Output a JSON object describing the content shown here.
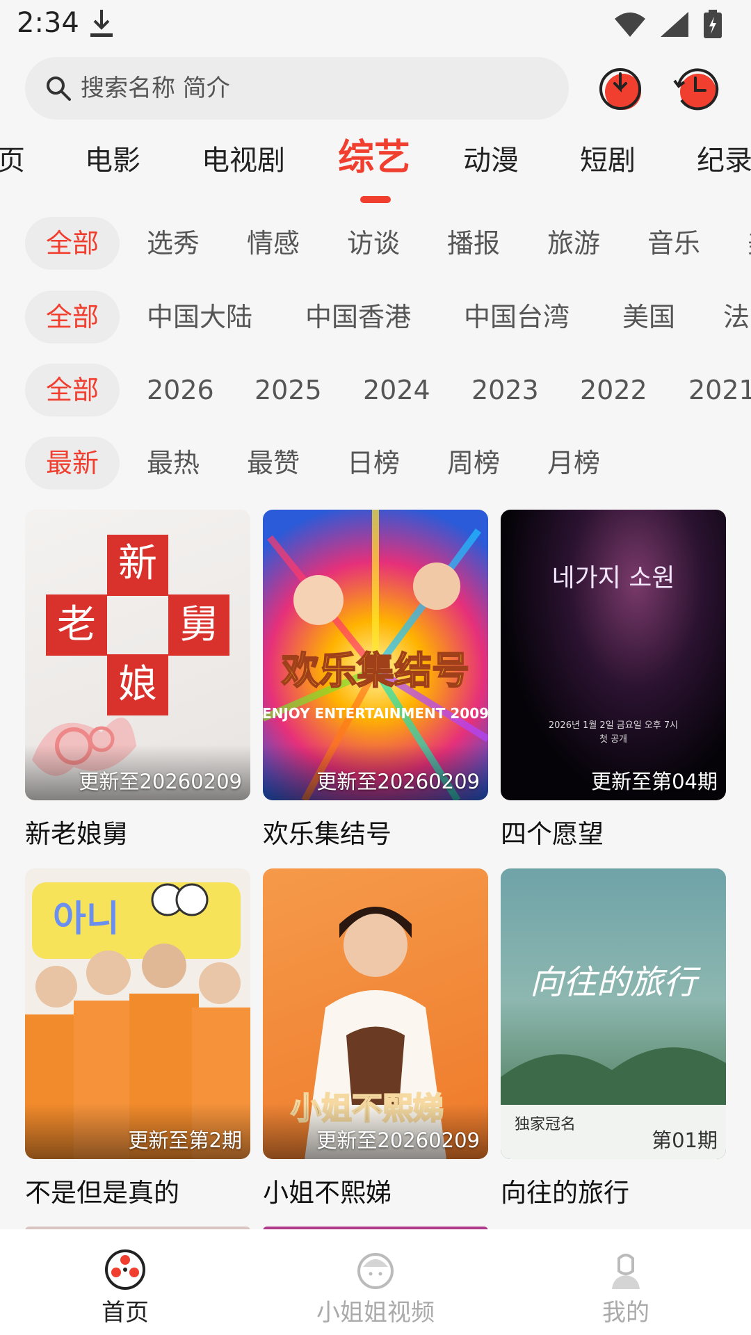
{
  "status_bar": {
    "time": "2:34"
  },
  "search": {
    "placeholder": "搜索名称 简介"
  },
  "tabs": [
    {
      "label": "页"
    },
    {
      "label": "电影"
    },
    {
      "label": "电视剧"
    },
    {
      "label": "综艺"
    },
    {
      "label": "动漫"
    },
    {
      "label": "短剧"
    },
    {
      "label": "纪录"
    }
  ],
  "active_tab": "综艺",
  "filters": {
    "genre": [
      "全部",
      "选秀",
      "情感",
      "访谈",
      "播报",
      "旅游",
      "音乐",
      "美"
    ],
    "region": [
      "全部",
      "中国大陆",
      "中国香港",
      "中国台湾",
      "美国",
      "法"
    ],
    "year": [
      "全部",
      "2026",
      "2025",
      "2024",
      "2023",
      "2022",
      "2021"
    ],
    "sort": [
      "最新",
      "最热",
      "最赞",
      "日榜",
      "周榜",
      "月榜"
    ]
  },
  "cards": [
    {
      "title": "新老娘舅",
      "badge": "更新至20260209"
    },
    {
      "title": "欢乐集结号",
      "badge": "更新至20260209"
    },
    {
      "title": "四个愿望",
      "badge": "更新至第04期"
    },
    {
      "title": "不是但是真的",
      "badge": "更新至第2期"
    },
    {
      "title": "小姐不熙娣",
      "badge": "更新至20260209"
    },
    {
      "title": "向往的旅行",
      "badge": "第01期"
    }
  ],
  "poster_text": {
    "card1": [
      "新",
      "老",
      "舅",
      "娘"
    ],
    "card2_logo": "欢乐集结号",
    "card2_sub": "ENJOY ENTERTAINMENT 2009",
    "card3_title": "네가지 소원",
    "card3_sub1": "2026년 1월 2일 금요일 오후 7시",
    "card3_sub2": "첫 공개",
    "card4_top": "아니",
    "card5_logo": "小姐不熙娣",
    "card6_logo": "向往的旅行",
    "card6_tag": "独家冠名"
  },
  "bottom_nav": [
    {
      "label": "首页",
      "icon": "film-reel-icon"
    },
    {
      "label": "小姐姐视频",
      "icon": "face-icon"
    },
    {
      "label": "我的",
      "icon": "profile-icon"
    }
  ],
  "colors": {
    "accent": "#f03e2f"
  }
}
